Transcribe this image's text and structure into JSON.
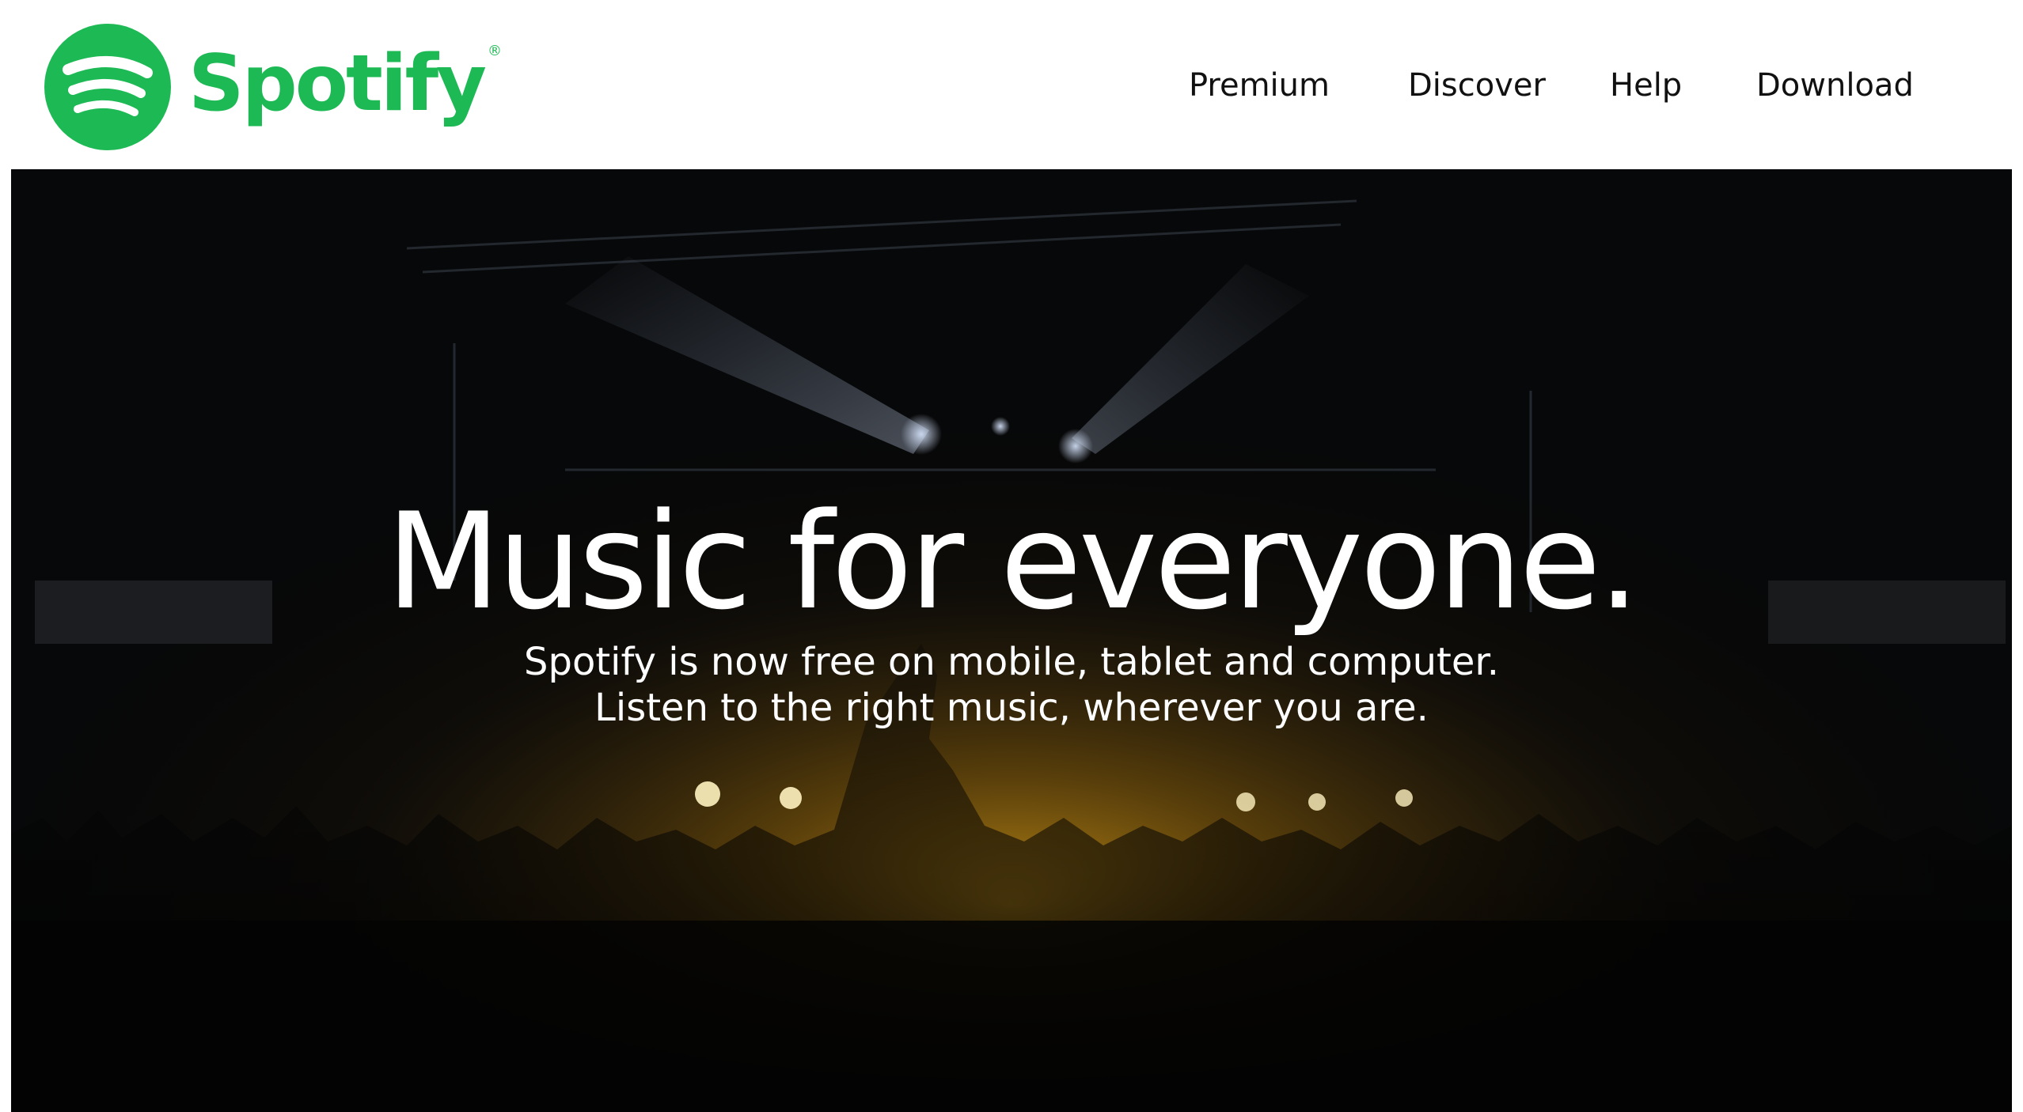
{
  "brand": {
    "name": "Spotify",
    "registered_mark": "®",
    "color": "#1db954",
    "icon": "spotify-logo-icon"
  },
  "nav": {
    "items": [
      {
        "label": "Premium"
      },
      {
        "label": "Discover"
      },
      {
        "label": "Help"
      },
      {
        "label": "Download"
      }
    ]
  },
  "hero": {
    "title": "Music for everyone.",
    "subtitle_line1": "Spotify is now free on mobile, tablet and computer.",
    "subtitle_line2": "Listen to the right music, wherever you are.",
    "background_image": "concert-crowd-photo",
    "text_color": "#ffffff",
    "stage_light_color": "#e0a418"
  }
}
